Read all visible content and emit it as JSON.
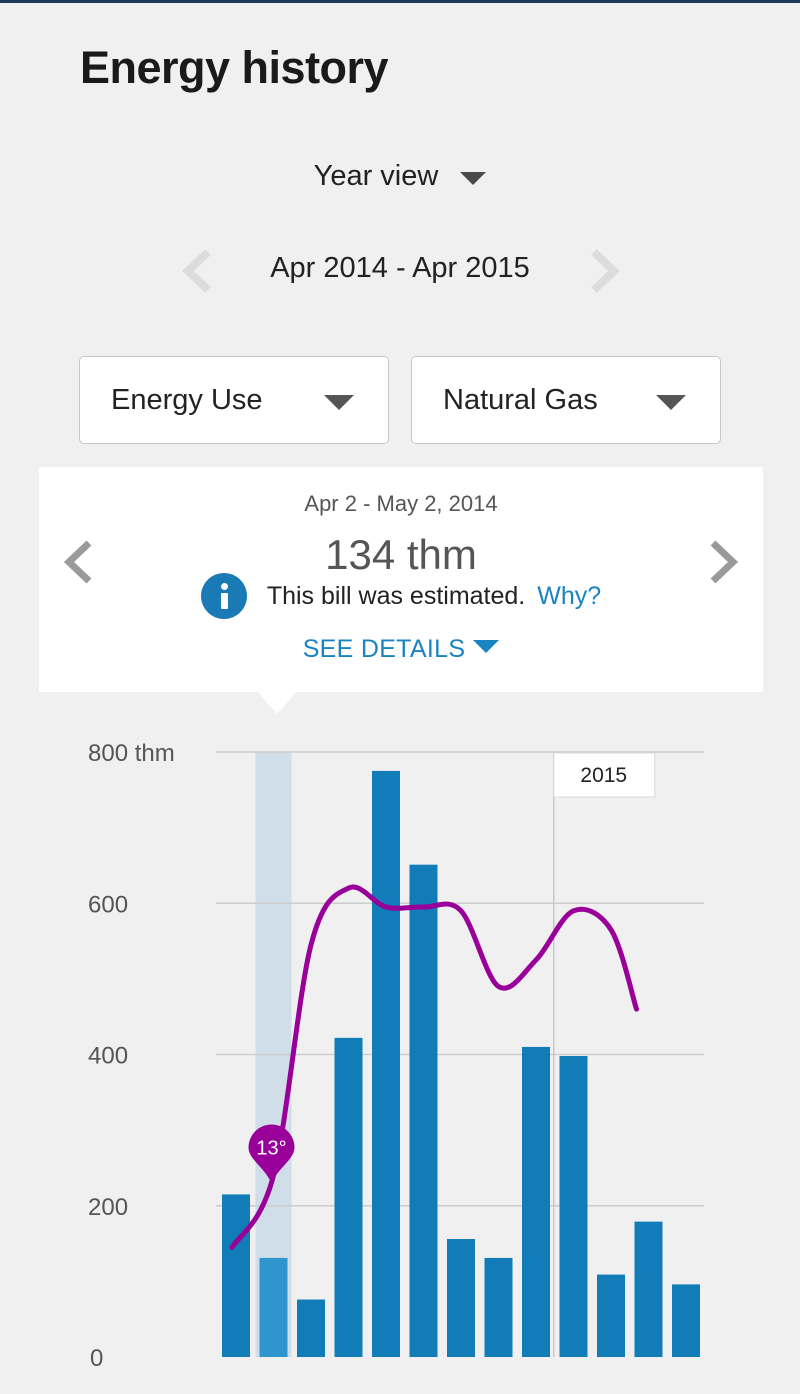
{
  "page": {
    "title": "Energy history"
  },
  "view_selector": {
    "label": "Year view"
  },
  "date_range": {
    "label": "Apr 2014 - Apr 2015"
  },
  "filters": {
    "metric": "Energy Use",
    "fuel": "Natural Gas"
  },
  "bill_detail": {
    "period": "Apr 2 - May 2, 2014",
    "value": "134 thm",
    "estimated_text": "This bill was estimated.",
    "why_link": "Why?",
    "see_details": "SEE DETAILS"
  },
  "icons": {
    "view_dropdown": "chevron-down-icon",
    "prev_range": "chevron-left-icon",
    "next_range": "chevron-right-icon",
    "info": "info-icon"
  },
  "colors": {
    "bar": "#117cb7",
    "bar_selected": "#2e95cd",
    "selected_band": "#cfdee8",
    "temperature_line": "#990099",
    "link": "#1a84c0",
    "info_icon": "#1a7ab5"
  },
  "chart_data": {
    "type": "bar",
    "unit": "thm",
    "ylim": [
      0,
      800
    ],
    "yticks": [
      "0",
      "200",
      "400",
      "600",
      "800 thm"
    ],
    "grid": true,
    "year_marker": "2015",
    "selected_index": 1,
    "values": [
      215,
      131,
      76,
      422,
      775,
      651,
      156,
      131,
      410,
      398,
      109,
      179,
      96
    ],
    "temperature_line": {
      "values": [
        145,
        240,
        545,
        620,
        595,
        595,
        590,
        490,
        525,
        590,
        565,
        460
      ],
      "selected_label": "13°"
    }
  }
}
